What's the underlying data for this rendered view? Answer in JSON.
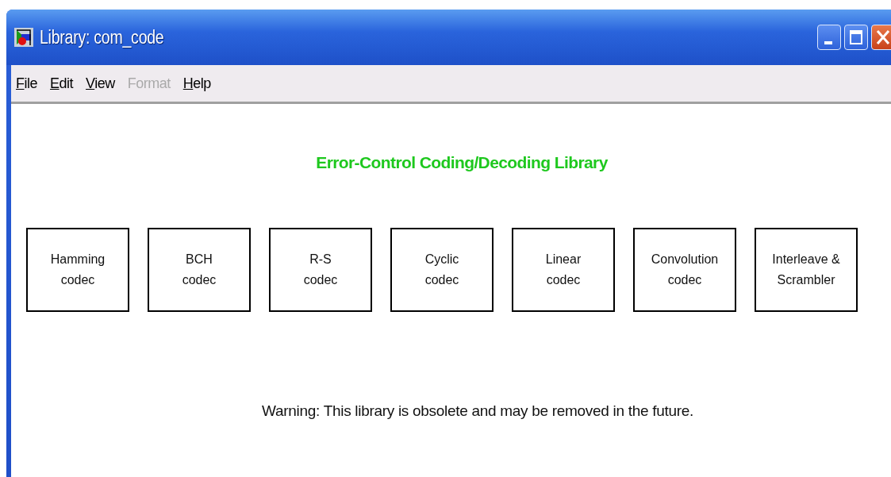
{
  "window": {
    "title": "Library: com_code"
  },
  "menu": [
    {
      "label": "File",
      "disabled": false
    },
    {
      "label": "Edit",
      "disabled": false
    },
    {
      "label": "View",
      "disabled": false
    },
    {
      "label": "Format",
      "disabled": true
    },
    {
      "label": "Help",
      "disabled": false
    }
  ],
  "heading": "Error-Control Coding/Decoding Library",
  "blocks": [
    {
      "lines": [
        "Hamming",
        "codec"
      ]
    },
    {
      "lines": [
        "BCH",
        "codec"
      ]
    },
    {
      "lines": [
        "R-S",
        "codec"
      ]
    },
    {
      "lines": [
        "Cyclic",
        "codec"
      ]
    },
    {
      "lines": [
        "Linear",
        "codec"
      ]
    },
    {
      "lines": [
        "Convolution",
        "codec"
      ]
    },
    {
      "lines": [
        "Interleave &",
        "Scrambler"
      ]
    }
  ],
  "warning": "Warning: This library is obsolete and may be removed in the future."
}
